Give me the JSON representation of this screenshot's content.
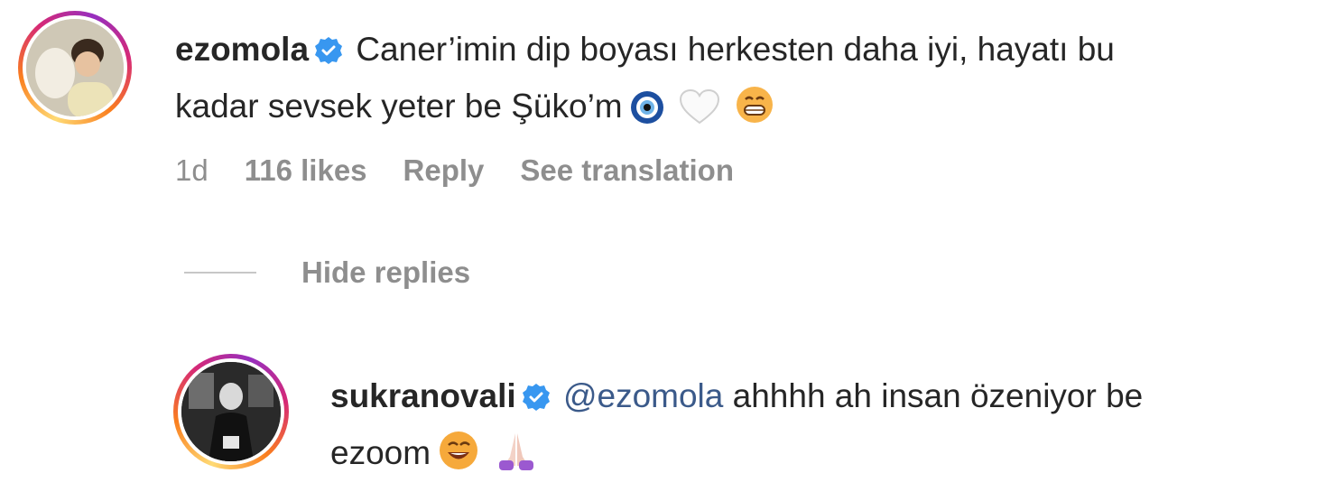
{
  "comment": {
    "username": "ezomola",
    "line1": "Caner’imin dip boyası herkesten daha iyi, hayatı bu",
    "line2": "kadar sevsek yeter be Şüko’m",
    "time": "1d",
    "likes": "116 likes",
    "reply_label": "Reply",
    "translate_label": "See translation"
  },
  "hide_replies_label": "Hide replies",
  "reply": {
    "username": "sukranovali",
    "mention": "@ezomola",
    "line1": "ahhhh ah insan özeniyor be",
    "line2": "ezoom"
  },
  "colors": {
    "text": "#262626",
    "secondary": "#8e8e8e",
    "verified": "#3897f0",
    "mention": "#3b5a8a"
  },
  "icons": [
    "verified-badge-icon",
    "nazar-emoji-icon",
    "white-heart-emoji-icon",
    "grinning-emoji-icon",
    "smiling-emoji-icon",
    "folded-hands-emoji-icon"
  ]
}
